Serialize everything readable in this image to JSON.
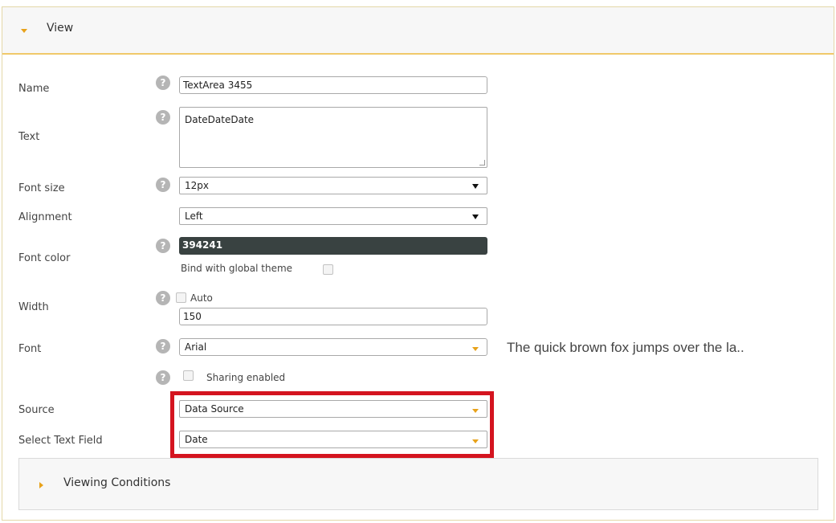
{
  "view_section": {
    "title": "View"
  },
  "fields": {
    "name": {
      "label": "Name",
      "value": "TextArea 3455"
    },
    "text": {
      "label": "Text",
      "value": "DateDateDate"
    },
    "font_size": {
      "label": "Font size",
      "value": "12px"
    },
    "alignment": {
      "label": "Alignment",
      "value": "Left"
    },
    "font_color": {
      "label": "Font color",
      "value": "394241",
      "swatch": "#394241",
      "bind_label": "Bind with global theme"
    },
    "width": {
      "label": "Width",
      "auto_label": "Auto",
      "value": "150"
    },
    "font": {
      "label": "Font",
      "value": "Arial",
      "preview": "The quick brown fox jumps over the la.."
    },
    "sharing": {
      "label": "Sharing enabled"
    },
    "source": {
      "label": "Source",
      "value": "Data Source"
    },
    "select_text_field": {
      "label": "Select Text Field",
      "value": "Date"
    }
  },
  "help_glyph": "?",
  "viewing_conditions": {
    "title": "Viewing Conditions"
  },
  "colors": {
    "accent": "#e8a21a",
    "header_border": "#f0c96a",
    "highlight": "#d4141f",
    "help_icon": "#b5b5b5"
  }
}
